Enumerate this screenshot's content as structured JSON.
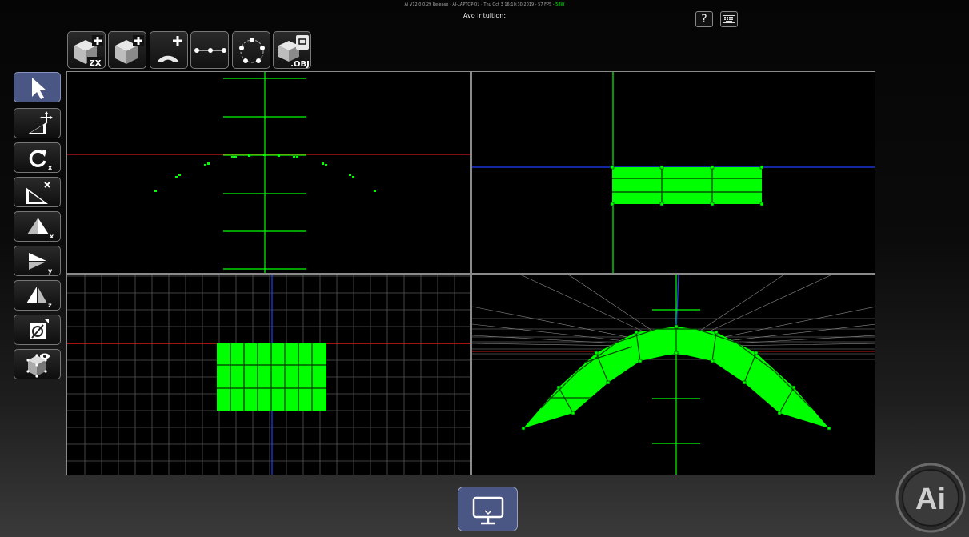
{
  "header": {
    "status_prefix": "Ai V12.0.0.29 Release - AI-LAPTOP-01 - Thu Oct  3 16:10:30 2019 - 57 FPS - ",
    "status_suffix": "58W",
    "title": "Avo Intuition:",
    "help_label": "?"
  },
  "toolbar": {
    "buttons": [
      {
        "name": "add-zx-surface-button",
        "icon": "cube-add-zx-icon",
        "badge": "ZX"
      },
      {
        "name": "add-cube-button",
        "icon": "cube-add-icon",
        "badge": ""
      },
      {
        "name": "add-arc-button",
        "icon": "arc-add-icon",
        "badge": ""
      },
      {
        "name": "add-line-points-button",
        "icon": "line-points-icon",
        "badge": ""
      },
      {
        "name": "add-circle-points-button",
        "icon": "circle-points-icon",
        "badge": ""
      },
      {
        "name": "import-obj-button",
        "icon": "obj-import-icon",
        "badge": ".OBJ"
      }
    ]
  },
  "sidebar": {
    "tools": [
      {
        "name": "select-tool",
        "icon": "pointer-icon",
        "active": true,
        "axis": ""
      },
      {
        "name": "move-tool",
        "icon": "move-icon",
        "active": false,
        "axis": ""
      },
      {
        "name": "rotate-tool",
        "icon": "rotate-icon",
        "active": false,
        "axis": "x"
      },
      {
        "name": "scale-tool",
        "icon": "scale-icon",
        "active": false,
        "axis": ""
      },
      {
        "name": "mirror-x-tool",
        "icon": "mirror-x-icon",
        "active": false,
        "axis": "x"
      },
      {
        "name": "mirror-y-tool",
        "icon": "mirror-y-icon",
        "active": false,
        "axis": "y"
      },
      {
        "name": "mirror-z-tool",
        "icon": "mirror-z-icon",
        "active": false,
        "axis": "z"
      },
      {
        "name": "delete-tool",
        "icon": "delete-icon",
        "active": false,
        "axis": ""
      },
      {
        "name": "view-tool",
        "icon": "cube-eye-icon",
        "active": false,
        "axis": ""
      }
    ]
  },
  "colors": {
    "mesh": "#00ff00",
    "axis_red": "#ff2020",
    "axis_blue": "#1f3fff",
    "grid": "#555555",
    "active_button": "#4a5785"
  },
  "logo": {
    "text": "Ai"
  }
}
